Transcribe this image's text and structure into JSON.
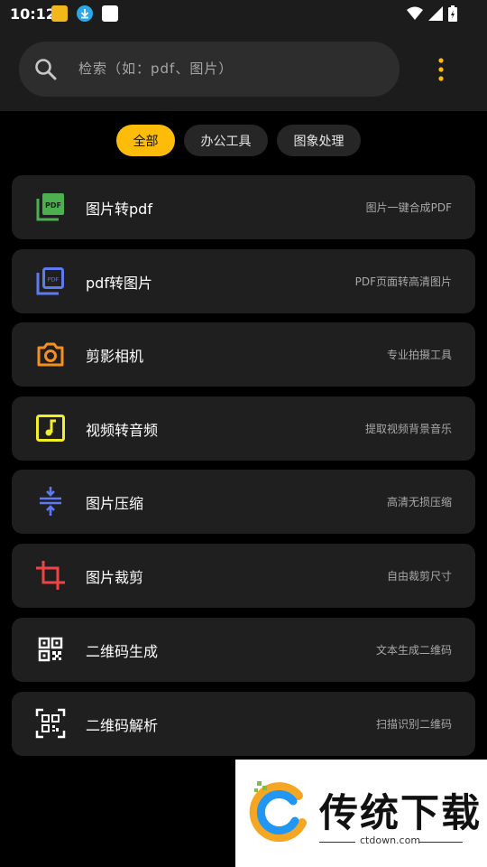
{
  "status_bar": {
    "time": "10:12",
    "notification_icons": [
      "app-icon",
      "download-icon",
      "app-icon"
    ],
    "system_icons": [
      "wifi-icon",
      "signal-icon",
      "battery-icon"
    ]
  },
  "search": {
    "placeholder": "检索（如：pdf、图片）"
  },
  "chips": [
    {
      "label": "全部",
      "active": true
    },
    {
      "label": "办公工具",
      "active": false
    },
    {
      "label": "图象处理",
      "active": false
    }
  ],
  "tools": [
    {
      "title": "图片转pdf",
      "desc": "图片一键合成PDF",
      "icon": "image-to-pdf-icon",
      "color": "#4caf50"
    },
    {
      "title": "pdf转图片",
      "desc": "PDF页面转高清图片",
      "icon": "pdf-to-image-icon",
      "color": "#5f79f0"
    },
    {
      "title": "剪影相机",
      "desc": "专业拍摄工具",
      "icon": "camera-icon",
      "color": "#f5901e"
    },
    {
      "title": "视频转音频",
      "desc": "提取视频背景音乐",
      "icon": "music-note-icon",
      "color": "#f2ee2a"
    },
    {
      "title": "图片压缩",
      "desc": "高清无损压缩",
      "icon": "compress-icon",
      "color": "#5f79f0"
    },
    {
      "title": "图片裁剪",
      "desc": "自由裁剪尺寸",
      "icon": "crop-icon",
      "color": "#ee4444"
    },
    {
      "title": "二维码生成",
      "desc": "文本生成二维码",
      "icon": "qr-code-icon",
      "color": "#ffffff"
    },
    {
      "title": "二维码解析",
      "desc": "扫描识别二维码",
      "icon": "qr-scan-icon",
      "color": "#ffffff"
    }
  ],
  "watermark": {
    "name": "传统下载",
    "url": "ctdown.com"
  }
}
